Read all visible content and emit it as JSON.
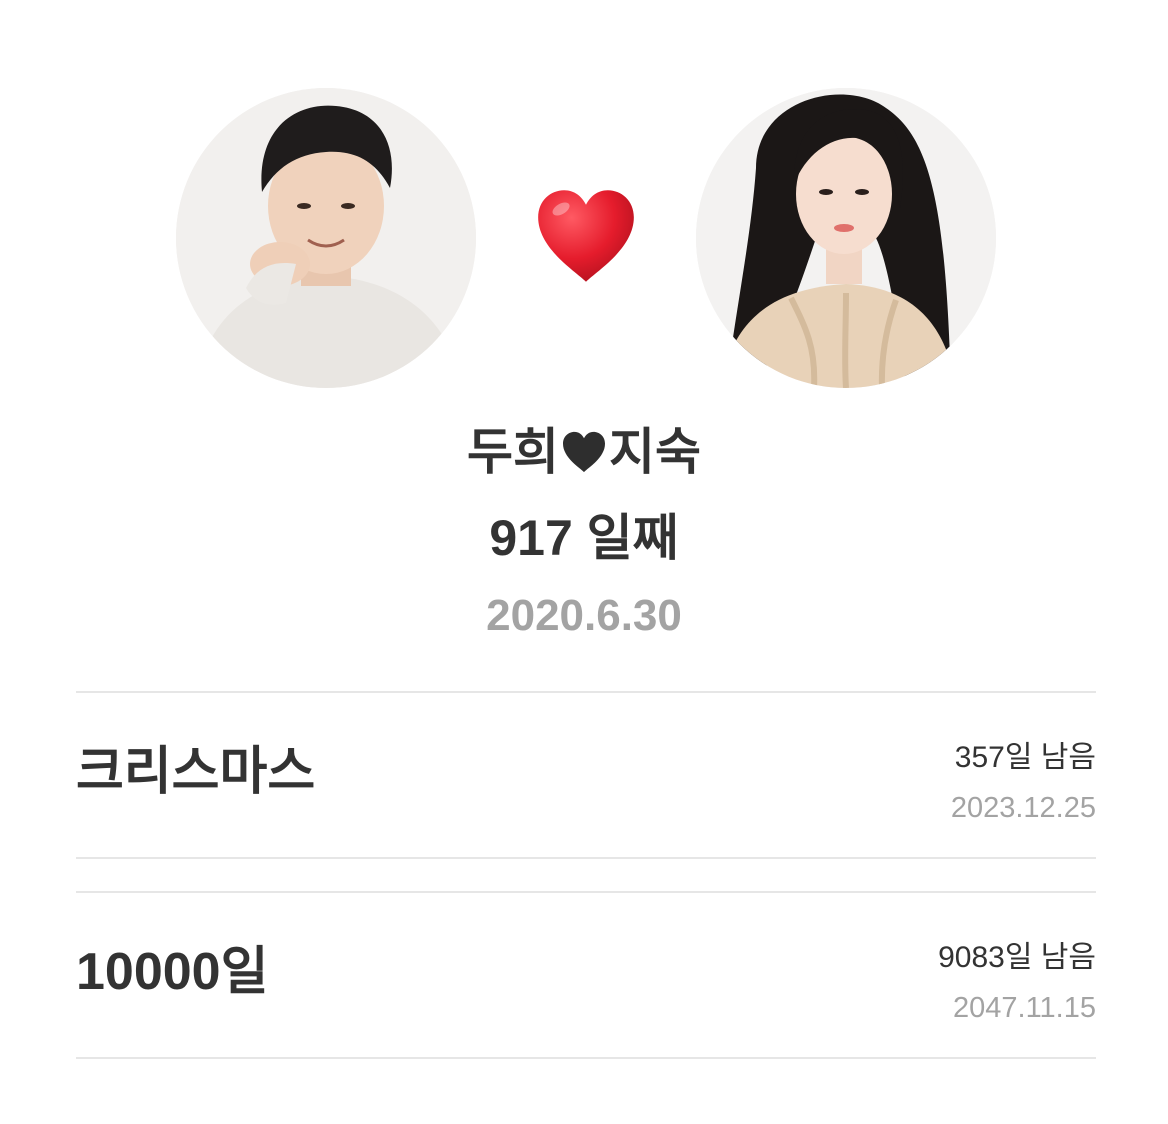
{
  "couple": {
    "left_avatar": "male-partner-photo",
    "right_avatar": "female-partner-photo",
    "center_icon": "red-heart-icon",
    "name_left": "두희",
    "name_right": "지숙",
    "name_separator_icon": "black-heart-icon",
    "day_count": "917 일째",
    "start_date": "2020.6.30"
  },
  "events": [
    {
      "title": "크리스마스",
      "remaining": "357일 남음",
      "date": "2023.12.25"
    },
    {
      "title": "10000일",
      "remaining": "9083일 남음",
      "date": "2047.11.15"
    }
  ],
  "colors": {
    "heart_red": "#e11b2b",
    "primary_text": "#333333",
    "secondary_text": "#a3a3a3",
    "divider": "#e6e6e6"
  }
}
